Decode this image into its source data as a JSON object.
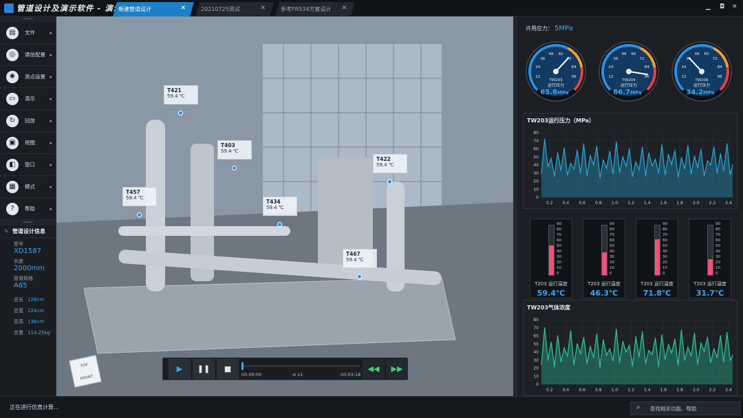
{
  "app": {
    "title": "管道设计及演示软件 - 演示"
  },
  "tabs": [
    {
      "label": "新建管道设计",
      "active": true
    },
    {
      "label": "20210725测试",
      "active": false
    },
    {
      "label": "参考FR534方案设计",
      "active": false
    }
  ],
  "window_controls": {
    "min": "▁",
    "max": "◘",
    "close": "✕"
  },
  "sidebar": {
    "grip": "===",
    "items": [
      {
        "label": "文件",
        "icon": "file-icon",
        "glyph": "▤"
      },
      {
        "label": "通信配置",
        "icon": "signal-icon",
        "glyph": "◎"
      },
      {
        "label": "测点设置",
        "icon": "gear-icon",
        "glyph": "✺"
      },
      {
        "label": "演示",
        "icon": "monitor-icon",
        "glyph": "▭"
      },
      {
        "label": "回放",
        "icon": "replay-icon",
        "glyph": "↻"
      },
      {
        "label": "视图",
        "icon": "view-icon",
        "glyph": "▣"
      },
      {
        "label": "窗口",
        "icon": "window-icon",
        "glyph": "◧"
      },
      {
        "label": "模式",
        "icon": "grid-icon",
        "glyph": "▦"
      },
      {
        "label": "帮助",
        "icon": "help-icon",
        "glyph": "?"
      }
    ],
    "info": {
      "title": "管道设计信息",
      "model_label": "型号",
      "model": "XD1587",
      "length_label": "长度",
      "length": "2000mm",
      "spec_label": "管道规格",
      "spec": "A65",
      "rows": [
        {
          "k": "总长",
          "v": "128cm"
        },
        {
          "k": "总宽",
          "v": "224cm"
        },
        {
          "k": "总高",
          "v": "136cm"
        },
        {
          "k": "总重",
          "v": "114.25kg"
        }
      ]
    }
  },
  "scene": {
    "tags": [
      {
        "name": "T421",
        "value": "59.4 ℃"
      },
      {
        "name": "T403",
        "value": "59.4 ℃"
      },
      {
        "name": "T422",
        "value": "59.4 ℃"
      },
      {
        "name": "T457",
        "value": "59.4 ℃"
      },
      {
        "name": "T434",
        "value": "59.4 ℃"
      },
      {
        "name": "T467",
        "value": "59.4 ℃"
      }
    ],
    "cube": {
      "top": "TOP",
      "front": "FRONT"
    }
  },
  "player": {
    "current": "00:00:00",
    "speed": "x1",
    "total": "00:03:18",
    "progress": 0.0
  },
  "right": {
    "limit_label": "许用应力：",
    "limit_value": "5MPa",
    "gauges": [
      {
        "id": "TW203",
        "caption": "运行压力",
        "value": "65.8",
        "unit": "MPa",
        "needle": 65.8
      },
      {
        "id": "TW204",
        "caption": "运行压力",
        "value": "86.7",
        "unit": "MPa",
        "needle": 86.7
      },
      {
        "id": "TW206",
        "caption": "运行压力",
        "value": "34.2",
        "unit": "MPa",
        "needle": 34.2
      }
    ],
    "gauge_ticks": [
      "12",
      "24",
      "36",
      "48",
      "60",
      "72",
      "84",
      "96"
    ],
    "chart1_title": "TW203运行压力（MPa）",
    "chart2_title": "TW203气体浓度",
    "thermos": [
      {
        "label": "T203 运行温度",
        "value": "59.4",
        "unit": "℃",
        "level": 59.4
      },
      {
        "label": "T203 运行温度",
        "value": "46.3",
        "unit": "℃",
        "level": 46.3
      },
      {
        "label": "T203 运行温度",
        "value": "71.8",
        "unit": "℃",
        "level": 71.8
      },
      {
        "label": "T203 运行温度",
        "value": "31.7",
        "unit": "℃",
        "level": 31.7
      }
    ],
    "thermo_ticks": [
      "90",
      "80",
      "70",
      "60",
      "50",
      "40",
      "30",
      "20",
      "10",
      "0"
    ]
  },
  "colors": {
    "accent": "#3ea6f0",
    "chart1": "#27a9d8",
    "chart2": "#2fc79a",
    "thermo": "#f0507a"
  },
  "chart_data": [
    {
      "type": "area",
      "title": "TW203运行压力（MPa）",
      "x_ticks": [
        0.2,
        0.4,
        0.6,
        0.8,
        1.0,
        1.2,
        1.4,
        1.6,
        1.8,
        2.0,
        2.2,
        2.4
      ],
      "y_ticks": [
        0,
        10,
        20,
        30,
        40,
        50,
        60,
        70,
        80
      ],
      "ylim": [
        0,
        80
      ],
      "xlim": [
        0.1,
        2.45
      ],
      "x": [
        0.1,
        0.14,
        0.18,
        0.22,
        0.26,
        0.3,
        0.34,
        0.38,
        0.42,
        0.46,
        0.5,
        0.54,
        0.58,
        0.62,
        0.66,
        0.7,
        0.74,
        0.78,
        0.82,
        0.86,
        0.9,
        0.94,
        0.98,
        1.02,
        1.06,
        1.1,
        1.14,
        1.18,
        1.22,
        1.26,
        1.3,
        1.34,
        1.38,
        1.42,
        1.46,
        1.5,
        1.54,
        1.58,
        1.62,
        1.66,
        1.7,
        1.74,
        1.78,
        1.82,
        1.86,
        1.9,
        1.94,
        1.98,
        2.02,
        2.06,
        2.1,
        2.14,
        2.18,
        2.22,
        2.26,
        2.3,
        2.34,
        2.38,
        2.42,
        2.45
      ],
      "y": [
        30,
        72,
        38,
        48,
        26,
        55,
        33,
        61,
        28,
        42,
        35,
        58,
        30,
        66,
        27,
        52,
        40,
        63,
        24,
        46,
        36,
        57,
        29,
        68,
        31,
        50,
        38,
        60,
        26,
        44,
        34,
        62,
        27,
        55,
        39,
        47,
        30,
        65,
        28,
        53,
        41,
        58,
        25,
        49,
        35,
        64,
        29,
        51,
        37,
        59,
        27,
        45,
        40,
        62,
        30,
        54,
        33,
        66,
        28,
        40
      ]
    },
    {
      "type": "area",
      "title": "TW203气体浓度",
      "x_ticks": [
        0.2,
        0.4,
        0.6,
        0.8,
        1.0,
        1.2,
        1.4,
        1.6,
        1.8,
        2.0,
        2.2,
        2.4
      ],
      "y_ticks": [
        0,
        10,
        20,
        30,
        40,
        50,
        60,
        70,
        80
      ],
      "ylim": [
        0,
        80
      ],
      "xlim": [
        0.1,
        2.45
      ],
      "x": [
        0.1,
        0.14,
        0.18,
        0.22,
        0.26,
        0.3,
        0.34,
        0.38,
        0.42,
        0.46,
        0.5,
        0.54,
        0.58,
        0.62,
        0.66,
        0.7,
        0.74,
        0.78,
        0.82,
        0.86,
        0.9,
        0.94,
        0.98,
        1.02,
        1.06,
        1.1,
        1.14,
        1.18,
        1.22,
        1.26,
        1.3,
        1.34,
        1.38,
        1.42,
        1.46,
        1.5,
        1.54,
        1.58,
        1.62,
        1.66,
        1.7,
        1.74,
        1.78,
        1.82,
        1.86,
        1.9,
        1.94,
        1.98,
        2.02,
        2.06,
        2.1,
        2.14,
        2.18,
        2.22,
        2.26,
        2.3,
        2.34,
        2.38,
        2.42,
        2.45
      ],
      "y": [
        25,
        70,
        30,
        52,
        22,
        60,
        28,
        45,
        35,
        66,
        24,
        50,
        38,
        58,
        26,
        47,
        33,
        62,
        21,
        55,
        36,
        44,
        29,
        68,
        27,
        53,
        40,
        48,
        23,
        59,
        34,
        65,
        26,
        42,
        37,
        57,
        22,
        61,
        31,
        49,
        39,
        56,
        24,
        67,
        30,
        46,
        35,
        63,
        25,
        51,
        41,
        58,
        27,
        44,
        33,
        60,
        28,
        64,
        30,
        36
      ]
    }
  ],
  "status": {
    "text": "正在进行仿真计算..."
  },
  "search": {
    "placeholder": "查找相关功能、帮助"
  }
}
